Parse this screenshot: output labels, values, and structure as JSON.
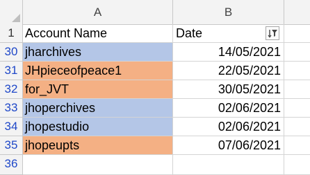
{
  "columns": {
    "a": "A",
    "b": "B"
  },
  "header_row": {
    "row_num": "1",
    "account_label": "Account Name",
    "date_label": "Date"
  },
  "rows": [
    {
      "row_num": "30",
      "account": "jharchives",
      "date": "14/05/2021",
      "fill": "#b4c6e7"
    },
    {
      "row_num": "31",
      "account": "JHpieceofpeace1",
      "date": "22/05/2021",
      "fill": "#f4b084"
    },
    {
      "row_num": "32",
      "account": "for_JVT",
      "date": "30/05/2021",
      "fill": "#f4b084"
    },
    {
      "row_num": "33",
      "account": "jhoperchives",
      "date": "02/06/2021",
      "fill": "#b4c6e7"
    },
    {
      "row_num": "34",
      "account": "jhopestudio",
      "date": "02/06/2021",
      "fill": "#b4c6e7"
    },
    {
      "row_num": "35",
      "account": "jhopeupts",
      "date": "07/06/2021",
      "fill": "#f4b084"
    }
  ],
  "empty_row": {
    "row_num": "36"
  },
  "colors": {
    "row_number_filtered": "#1e47c8",
    "blue_fill": "#b4c6e7",
    "orange_fill": "#f4b084"
  },
  "icons": {
    "filter": "filter-sort-icon",
    "select_all": "select-all-corner-icon"
  }
}
